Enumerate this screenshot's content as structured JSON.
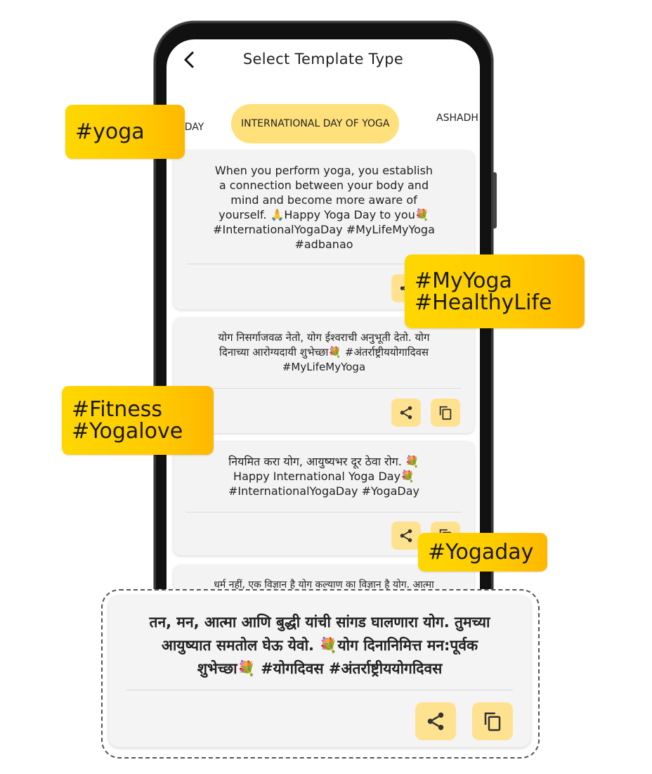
{
  "app": {
    "title": "Select Template Type",
    "back_icon": "chevron-left-icon"
  },
  "tabs": [
    {
      "label": "ER'S DAY",
      "active": false
    },
    {
      "label": "INTERNATIONAL DAY OF YOGA",
      "active": true
    },
    {
      "label": "ASHADH",
      "active": false
    }
  ],
  "colors": {
    "accent": "#FFE07A",
    "action_button": "#FFE28F",
    "sticker": "#FFCB00",
    "card": "#F3F3F3"
  },
  "templates": [
    {
      "text": "When you perform yoga, you establish\na connection between your body and\nmind and become more aware of\nyourself. 🙏Happy Yoga Day to you💐\n#InternationalYogaDay  #MyLifeMyYoga\n#adbanao",
      "share_icon": "share-icon",
      "copy_icon": "copy-icon"
    },
    {
      "text": "योग निसर्गाजवळ नेतो, योग ईश्वराची अनुभूती देतो. योग\nदिनाच्या आरोग्यदायी शुभेच्छा💐  #अंतर्राष्ट्रीययोगादिवस\n#MyLifeMyYoga",
      "share_icon": "share-icon",
      "copy_icon": "copy-icon"
    },
    {
      "text": "नियमित करा योग, आयुष्यभर दूर ठेवा रोग. 💐\nHappy International Yoga Day💐\n#InternationalYogaDay  #YogaDay",
      "share_icon": "share-icon",
      "copy_icon": "copy-icon"
    },
    {
      "text": "धर्म नहीं, एक विज्ञान है योग कल्याण का विज्ञान है योग. आत्मा\nका विज्ञान है योग.  शरीर, मन और आत्मा को जोड़ने का विज्ञान",
      "share_icon": "share-icon",
      "copy_icon": "copy-icon"
    }
  ],
  "zoom_template": {
    "text": "तन, मन, आत्मा आणि बुद्धी यांची सांगड घालणारा योग. तुमच्या\nआयुष्यात समतोल घेऊ येवो. 💐योग दिनानिमित्त मन:पूर्वक\nशुभेच्छा💐    #योगदिवस #अंतर्राष्ट्रीययोगदिवस",
    "share_icon": "share-icon",
    "copy_icon": "copy-icon"
  },
  "stickers": {
    "yoga": [
      "#yoga"
    ],
    "myyoga": [
      "#MyYoga",
      "#HealthyLife"
    ],
    "fitness": [
      "#Fitness",
      "#Yogalove"
    ],
    "yogaday": [
      "#Yogaday"
    ]
  }
}
